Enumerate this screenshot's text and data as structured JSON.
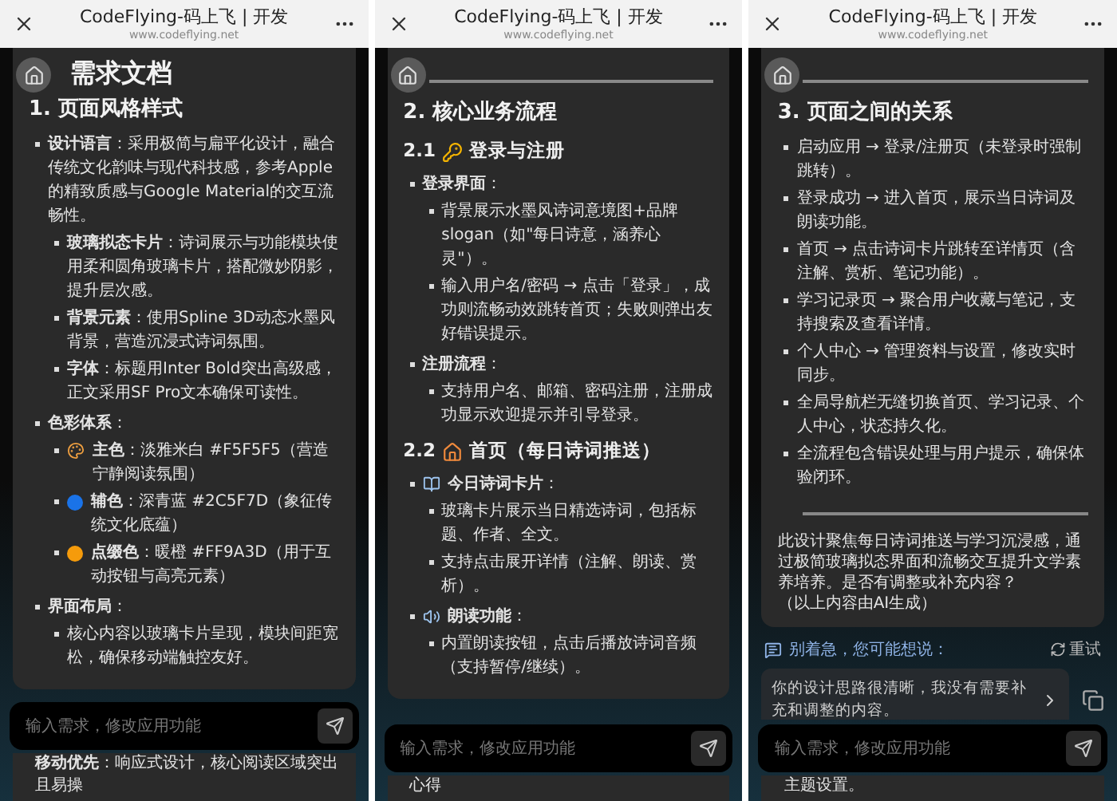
{
  "panels": [
    {
      "header": {
        "title": "CodeFlying-码上飞 | 开发",
        "url": "www.codeflying.net"
      },
      "card": [
        {
          "kind": "h1",
          "text": "需求文档"
        },
        {
          "kind": "h2",
          "text": "1. 页面风格样式"
        },
        {
          "kind": "list",
          "items": [
            {
              "text": "**设计语言**：采用极简与扁平化设计，融合传统文化韵味与现代科技感，参考Apple的精致质感与Google Material的交互流畅性。",
              "children": [
                {
                  "text": "**玻璃拟态卡片**：诗词展示与功能模块使用柔和圆角玻璃卡片，搭配微妙阴影，提升层次感。"
                },
                {
                  "text": "**背景元素**：使用Spline 3D动态水墨风背景，营造沉浸式诗词氛围。"
                },
                {
                  "text": "**字体**：标题用Inter Bold突出高级感，正文采用SF Pro文本确保可读性。"
                }
              ]
            },
            {
              "text": "**色彩体系**：",
              "children": [
                {
                  "text": "**主色**：淡雅米白 #F5F5F5（营造宁静阅读氛围）"
                },
                {
                  "text": "**辅色**：深青蓝 #2C5F7D（象征传统文化底蕴）",
                  "color": "#1a73e8"
                },
                {
                  "text": "**点缀色**：暖橙 #FF9A3D（用于互动按钮与高亮元素）",
                  "color": "#f59b0b"
                }
              ]
            },
            {
              "text": "**界面布局**：",
              "children": [
                {
                  "text": "核心内容以玻璃卡片呈现，模块间距宽松，确保移动端触控友好。"
                }
              ]
            }
          ]
        }
      ],
      "input": {
        "placeholder": "输入需求，修改应用功能"
      },
      "trailing": "**移动优先**：响应式设计，核心阅读区域突出且易操"
    },
    {
      "header": {
        "title": "CodeFlying-码上飞 | 开发",
        "url": "www.codeflying.net"
      },
      "card": [
        {
          "kind": "rule"
        },
        {
          "kind": "h2",
          "text": "2. 核心业务流程"
        },
        {
          "kind": "h3",
          "text": "2.1",
          "after": "登录与注册"
        },
        {
          "kind": "list",
          "items": [
            {
              "text": "**登录界面**：",
              "children": [
                {
                  "text": "背景展示水墨风诗词意境图+品牌slogan（如\"每日诗意，涵养心灵\"）。"
                },
                {
                  "text": "输入用户名/密码 → 点击「登录」，成功则流畅动效跳转首页；失败则弹出友好错误提示。"
                }
              ]
            },
            {
              "text": "**注册流程**：",
              "children": [
                {
                  "text": "支持用户名、邮箱、密码注册，注册成功显示欢迎提示并引导登录。"
                }
              ]
            }
          ]
        },
        {
          "kind": "h3",
          "text": "2.2",
          "after": "首页（每日诗词推送）"
        },
        {
          "kind": "list",
          "items": [
            {
              "text": "**今日诗词卡片**：",
              "children": [
                {
                  "text": "玻璃卡片展示当日精选诗词，包括标题、作者、全文。"
                },
                {
                  "text": "支持点击展开详情（注解、朗读、赏析）。"
                }
              ]
            },
            {
              "text": "**朗读功能**：",
              "children": [
                {
                  "text": "内置朗读按钮，点击后播放诗词音频（支持暂停/继续）。"
                }
              ]
            }
          ]
        }
      ],
      "input": {
        "placeholder": "输入需求，修改应用功能"
      },
      "trailing": "心得"
    },
    {
      "header": {
        "title": "CodeFlying-码上飞 | 开发",
        "url": "www.codeflying.net"
      },
      "card": [
        {
          "kind": "rule"
        },
        {
          "kind": "h2",
          "text": "3. 页面之间的关系"
        },
        {
          "kind": "list",
          "items": [
            {
              "text": "启动应用 → 登录/注册页（未登录时强制跳转）。"
            },
            {
              "text": "登录成功 → 进入首页，展示当日诗词及朗读功能。"
            },
            {
              "text": "首页 → 点击诗词卡片跳转至详情页（含注解、赏析、笔记功能）。"
            },
            {
              "text": "学习记录页 → 聚合用户收藏与笔记，支持搜索及查看详情。"
            },
            {
              "text": "个人中心 → 管理资料与设置，修改实时同步。"
            },
            {
              "text": "全局导航栏无缝切换首页、学习记录、个人中心，状态持久化。"
            },
            {
              "text": "全流程包含错误处理与用户提示，确保体验闭环。"
            }
          ]
        },
        {
          "kind": "rule"
        },
        {
          "kind": "para",
          "text": "此设计聚焦每日诗词推送与学习沉浸感，通过极简玻璃拟态界面和流畅交互提升文学素养培养。是否有调整或补充内容？"
        },
        {
          "kind": "para",
          "text": "（以上内容由AI生成）"
        }
      ],
      "prompt": {
        "label": "别着急，您可能想说：",
        "retry": "重试"
      },
      "suggestions": [
        "你的设计思路很清晰，我没有需要补充和调整的内容。"
      ],
      "input": {
        "placeholder": "输入需求，修改应用功能"
      },
      "trailing": "主题设置。"
    }
  ]
}
